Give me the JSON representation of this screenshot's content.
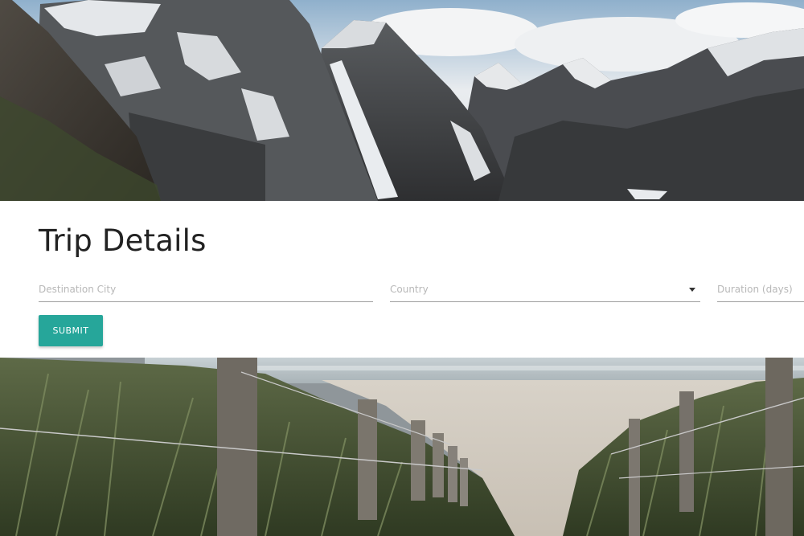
{
  "hero_top": {
    "image_subject": "mountain-landscape-banner"
  },
  "form": {
    "title": "Trip Details",
    "destination_placeholder": "Destination City",
    "country_placeholder": "Country",
    "duration_placeholder": "Duration (days)",
    "submit_label": "SUBMIT"
  },
  "hero_bottom": {
    "image_subject": "beach-path-banner"
  },
  "colors": {
    "accent": "#26a69a",
    "input_underline": "#9e9e9e",
    "placeholder": "#b8b8b8",
    "title_text": "#222222"
  },
  "icons": {
    "dropdown": "dropdown-arrow-icon"
  }
}
